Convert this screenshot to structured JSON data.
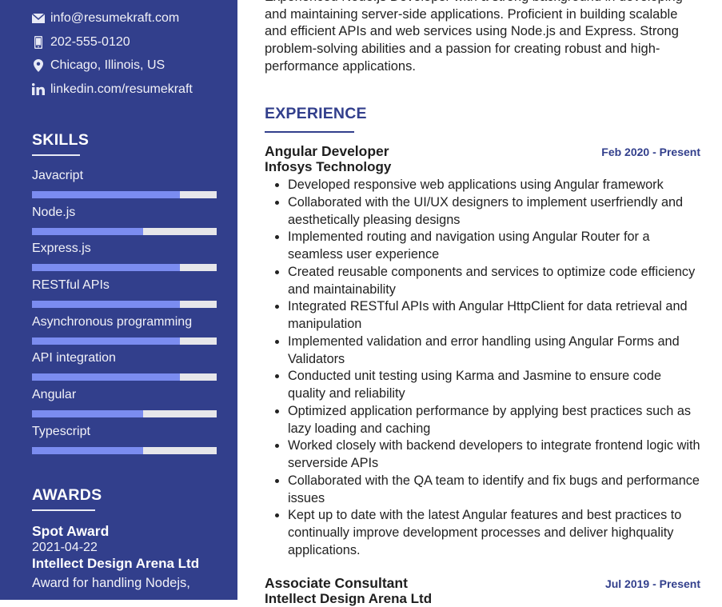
{
  "colors": {
    "sidebar_bg": "#323f8c",
    "skill_fill": "#7b8cf0",
    "skill_track": "#e6e6ea",
    "accent": "#323f8c"
  },
  "contact": [
    {
      "icon": "envelope-icon",
      "text": "info@resumekraft.com"
    },
    {
      "icon": "phone-icon",
      "text": "202-555-0120"
    },
    {
      "icon": "map-pin-icon",
      "text": "Chicago, Illinois, US"
    },
    {
      "icon": "linkedin-icon",
      "text": "linkedin.com/resumekraft"
    }
  ],
  "skills": {
    "title": "SKILLS",
    "items": [
      {
        "label": "Javacript",
        "level": 0.8
      },
      {
        "label": "Node.js",
        "level": 0.6
      },
      {
        "label": "Express.js",
        "level": 0.8
      },
      {
        "label": "RESTful APIs",
        "level": 0.8
      },
      {
        "label": "Asynchronous programming",
        "level": 0.8
      },
      {
        "label": "API integration",
        "level": 0.8
      },
      {
        "label": "Angular",
        "level": 0.6
      },
      {
        "label": "Typescript",
        "level": 0.6
      }
    ]
  },
  "awards": {
    "title": "AWARDS",
    "items": [
      {
        "name": "Spot Award",
        "date": "2021-04-22",
        "org": "Intellect Design Arena Ltd",
        "desc": "Award for handling Nodejs,"
      }
    ]
  },
  "summary": "Experienced Node.js Developer with a strong background in developing and maintaining server-side applications. Proficient in building scalable and efficient APIs and web services using Node.js and Express. Strong problem-solving abilities and a passion for creating robust and high-performance applications.",
  "experience": {
    "title": "EXPERIENCE",
    "jobs": [
      {
        "role": "Angular Developer",
        "date": "Feb 2020 - Present",
        "company": "Infosys Technology",
        "bullets": [
          "Developed responsive web applications using Angular framework",
          "Collaborated with the UI/UX designers to implement userfriendly and aesthetically pleasing designs",
          "Implemented routing and navigation using Angular Router for a seamless user experience",
          "Created reusable components and services to optimize code efficiency and maintainability",
          "Integrated RESTful APIs with Angular HttpClient for data retrieval and manipulation",
          "Implemented validation and error handling using Angular Forms and Validators",
          "Conducted unit testing using Karma and Jasmine to ensure code quality and reliability",
          "Optimized application performance by applying best practices such as lazy loading and caching",
          "Worked closely with backend developers to integrate frontend logic with serverside APIs",
          "Collaborated with the QA team to identify and fix bugs and performance issues",
          "Kept up to date with the latest Angular features and best practices to continually improve development processes and deliver highquality applications."
        ]
      },
      {
        "role": "Associate Consultant",
        "date": "Jul 2019 - Present",
        "company": "Intellect Design Arena Ltd",
        "bullets": []
      }
    ]
  }
}
